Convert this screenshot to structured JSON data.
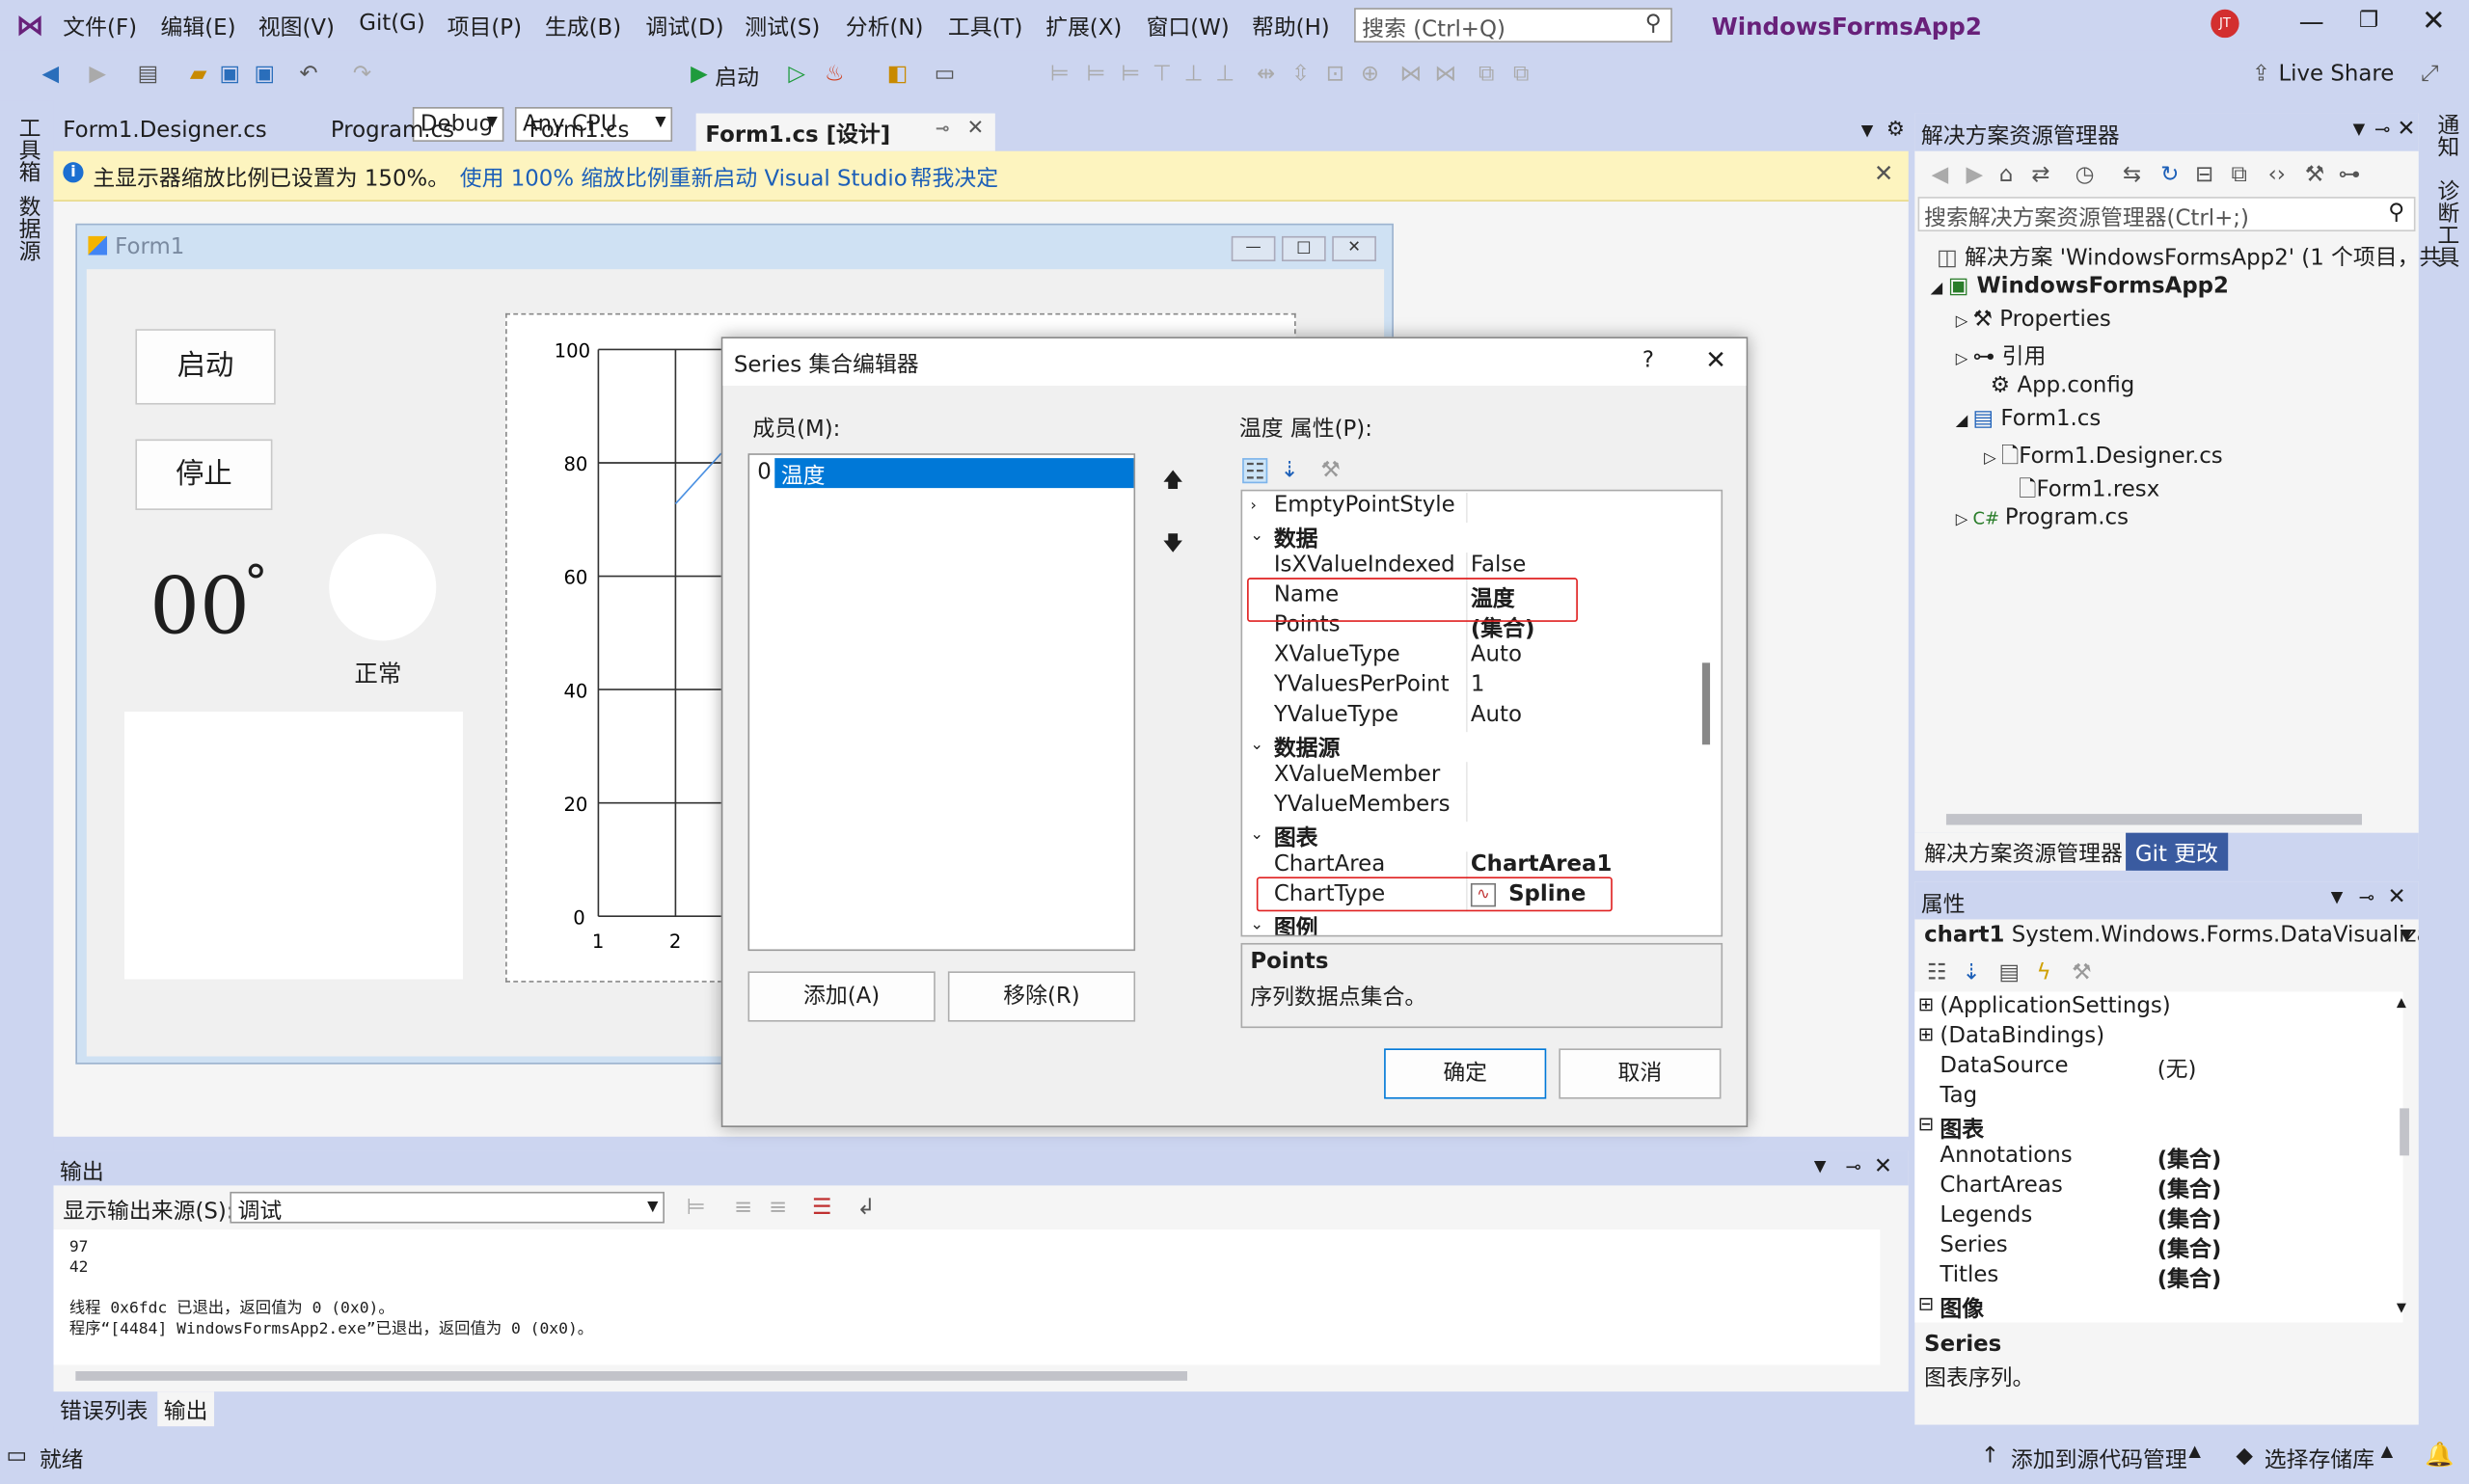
{
  "menubar": {
    "items": [
      "文件(F)",
      "编辑(E)",
      "视图(V)",
      "Git(G)",
      "项目(P)",
      "生成(B)",
      "调试(D)",
      "测试(S)",
      "分析(N)",
      "工具(T)",
      "扩展(X)",
      "窗口(W)",
      "帮助(H)"
    ],
    "search_placeholder": "搜索 (Ctrl+Q)",
    "solution_title": "WindowsFormsApp2",
    "avatar": "JT"
  },
  "toolbar": {
    "config": "Debug",
    "platform": "Any CPU",
    "start": "启动",
    "live_share": "Live Share"
  },
  "left_strip": [
    "工具箱",
    "数据源"
  ],
  "right_strip": [
    "通知",
    "诊断工具"
  ],
  "doc_tabs": [
    "Form1.Designer.cs",
    "Program.cs",
    "Form1.cs",
    "Form1.cs [设计]"
  ],
  "infobar": {
    "message": "主显示器缩放比例已设置为 150%。",
    "link1": "使用 100% 缩放比例重新启动 Visual Studio",
    "link2": "帮我决定"
  },
  "form": {
    "title": "Form1",
    "start_button": "启动",
    "stop_button": "停止",
    "temp_value": "00",
    "degree": "°",
    "status": "正常",
    "y_ticks": [
      "100",
      "80",
      "60",
      "40",
      "20",
      "0"
    ],
    "x_ticks": [
      "1",
      "2"
    ]
  },
  "dialog": {
    "title": "Series 集合编辑器",
    "help": "?",
    "members_label": "成员(M):",
    "member_index": "0",
    "member_name": "温度",
    "props_label": "温度 属性(P):",
    "grid_rows": [
      {
        "type": "prop",
        "key": "EmptyPointStyle",
        "value": "",
        "exp": "›"
      },
      {
        "type": "cat",
        "key": "数据",
        "exp": "⌄"
      },
      {
        "type": "prop",
        "key": "IsXValueIndexed",
        "value": "False"
      },
      {
        "type": "prop",
        "key": "Name",
        "value": "温度",
        "bold": true
      },
      {
        "type": "prop",
        "key": "Points",
        "value": "(集合)",
        "bold": true
      },
      {
        "type": "prop",
        "key": "XValueType",
        "value": "Auto"
      },
      {
        "type": "prop",
        "key": "YValuesPerPoint",
        "value": "1"
      },
      {
        "type": "prop",
        "key": "YValueType",
        "value": "Auto"
      },
      {
        "type": "cat",
        "key": "数据源",
        "exp": "⌄"
      },
      {
        "type": "prop",
        "key": "XValueMember",
        "value": ""
      },
      {
        "type": "prop",
        "key": "YValueMembers",
        "value": ""
      },
      {
        "type": "cat",
        "key": "图表",
        "exp": "⌄"
      },
      {
        "type": "prop",
        "key": "ChartArea",
        "value": "ChartArea1",
        "bold": true
      },
      {
        "type": "prop",
        "key": "ChartType",
        "value": "Spline",
        "bold": true
      },
      {
        "type": "cat",
        "key": "图例",
        "exp": "⌄"
      }
    ],
    "desc_title": "Points",
    "desc_text": "序列数据点集合。",
    "add_button": "添加(A)",
    "remove_button": "移除(R)",
    "ok_button": "确定",
    "cancel_button": "取消"
  },
  "solution_explorer": {
    "title": "解决方案资源管理器",
    "search_placeholder": "搜索解决方案资源管理器(Ctrl+;)",
    "tree": [
      {
        "label": "解决方案 'WindowsFormsApp2' (1 个项目，共",
        "bold": false
      },
      {
        "label": "WindowsFormsApp2",
        "bold": true
      },
      {
        "label": "Properties",
        "bold": false
      },
      {
        "label": "引用",
        "bold": false
      },
      {
        "label": "App.config",
        "bold": false
      },
      {
        "label": "Form1.cs",
        "bold": false
      },
      {
        "label": "Form1.Designer.cs",
        "bold": false
      },
      {
        "label": "Form1.resx",
        "bold": false
      },
      {
        "label": "Program.cs",
        "bold": false
      }
    ],
    "tab1": "解决方案资源管理器",
    "tab2": "Git 更改"
  },
  "properties": {
    "title": "属性",
    "object": "chart1",
    "object_type": "System.Windows.Forms.DataVisualizat",
    "rows": [
      {
        "type": "cat",
        "key": "(ApplicationSettings)",
        "exp": "⊞"
      },
      {
        "type": "cat",
        "key": "(DataBindings)",
        "exp": "⊞"
      },
      {
        "type": "prop",
        "key": "DataSource",
        "value": "(无)"
      },
      {
        "type": "prop",
        "key": "Tag",
        "value": ""
      },
      {
        "type": "cat",
        "key": "图表",
        "exp": "⊟"
      },
      {
        "type": "prop",
        "key": "Annotations",
        "value": "(集合)"
      },
      {
        "type": "prop",
        "key": "ChartAreas",
        "value": "(集合)"
      },
      {
        "type": "prop",
        "key": "Legends",
        "value": "(集合)"
      },
      {
        "type": "prop",
        "key": "Series",
        "value": "(集合)"
      },
      {
        "type": "prop",
        "key": "Titles",
        "value": "(集合)"
      },
      {
        "type": "cat",
        "key": "图像",
        "exp": "⊟"
      }
    ],
    "desc_title": "Series",
    "desc_text": "图表序列。"
  },
  "output": {
    "title": "输出",
    "source_label": "显示输出来源(S):",
    "source_value": "调试",
    "lines": [
      "97",
      "42",
      "",
      "线程 0x6fdc 已退出，返回值为 0 (0x0)。",
      "程序“[4484] WindowsFormsApp2.exe”已退出，返回值为 0 (0x0)。"
    ],
    "tab1": "错误列表",
    "tab2": "输出"
  },
  "statusbar": {
    "ready": "就绪",
    "source_control": "添加到源代码管理",
    "repo": "选择存储库"
  }
}
